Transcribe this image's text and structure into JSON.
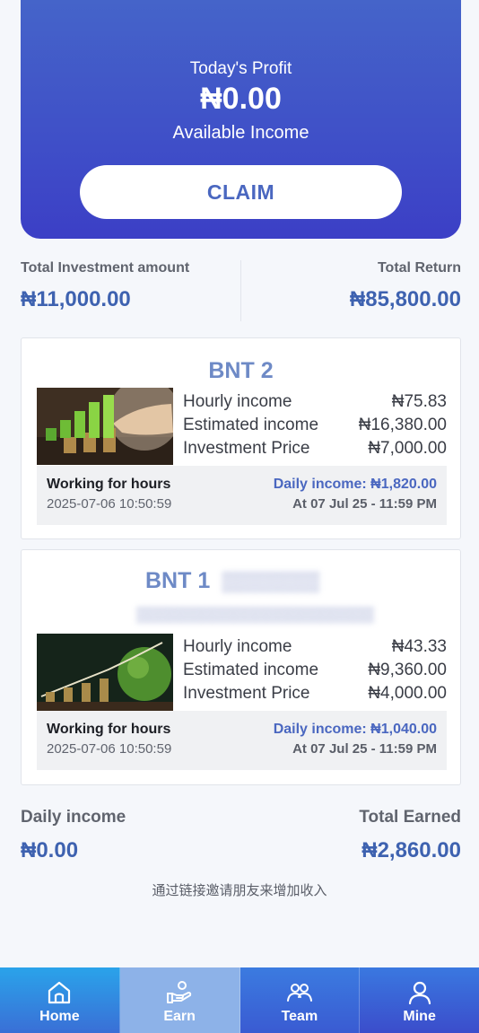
{
  "hero": {
    "today_label": "Today's Profit",
    "amount": "₦0.00",
    "available_label": "Available Income",
    "claim_label": "CLAIM"
  },
  "investment_summary": {
    "total_investment_label": "Total Investment amount",
    "total_investment_value": "₦11,000.00",
    "total_return_label": "Total Return",
    "total_return_value": "₦85,800.00"
  },
  "products": [
    {
      "name": "BNT 2",
      "hourly_label": "Hourly income",
      "hourly_value": "₦75.83",
      "estimated_label": "Estimated income",
      "estimated_value": "₦16,380.00",
      "price_label": "Investment Price",
      "price_value": "₦7,000.00",
      "working_label": "Working for hours",
      "timestamp": "2025-07-06 10:50:59",
      "daily_income": "Daily income: ₦1,820.00",
      "at_label": "At 07 Jul 25 - 11:59 PM"
    },
    {
      "name": "BNT 1",
      "hourly_label": "Hourly income",
      "hourly_value": "₦43.33",
      "estimated_label": "Estimated income",
      "estimated_value": "₦9,360.00",
      "price_label": "Investment Price",
      "price_value": "₦4,000.00",
      "working_label": "Working for hours",
      "timestamp": "2025-07-06 10:50:59",
      "daily_income": "Daily income: ₦1,040.00",
      "at_label": "At 07 Jul 25 - 11:59 PM"
    }
  ],
  "earnings_summary": {
    "daily_income_label": "Daily income",
    "daily_income_value": "₦0.00",
    "total_earned_label": "Total Earned",
    "total_earned_value": "₦2,860.00"
  },
  "invite_text": "通过链接邀请朋友来增加收入",
  "tabbar": {
    "items": [
      {
        "label": "Home",
        "icon": "home-icon"
      },
      {
        "label": "Earn",
        "icon": "hand-coin-icon",
        "active": true
      },
      {
        "label": "Team",
        "icon": "team-icon"
      },
      {
        "label": "Mine",
        "icon": "user-icon"
      }
    ]
  },
  "colors": {
    "accent": "#4a67c0",
    "hero_gradient_start": "#4564c9",
    "hero_gradient_end": "#3c3fc6",
    "active_tab": "#8db2e8"
  }
}
